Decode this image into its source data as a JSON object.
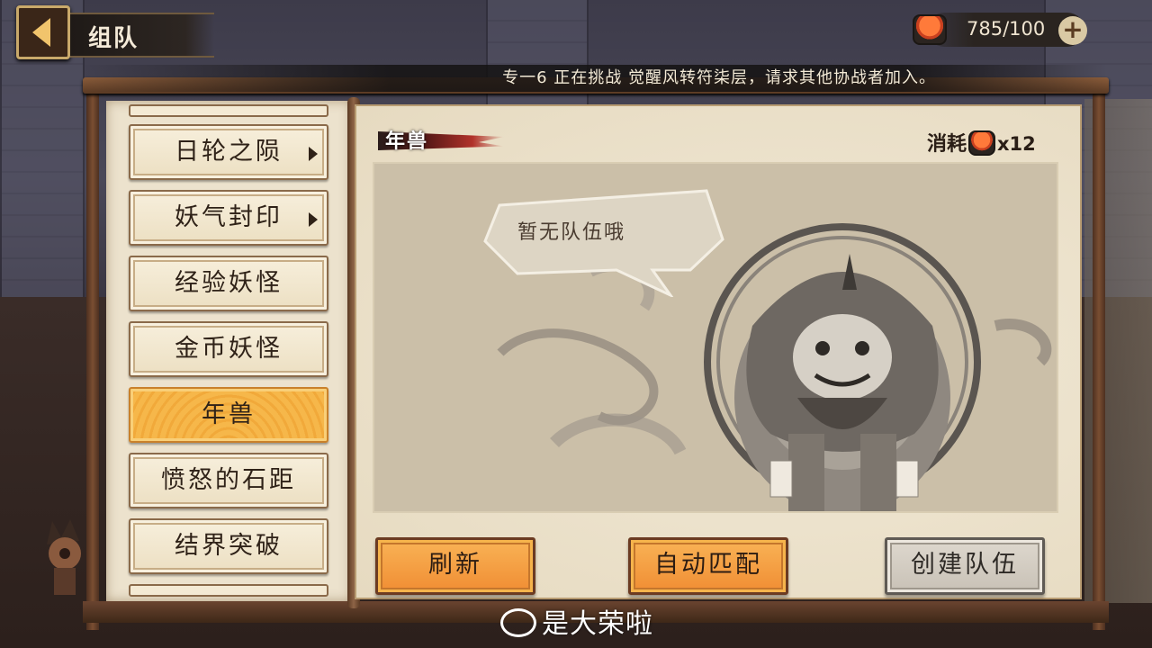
{
  "header": {
    "title": "组队",
    "currency_value": "785/100",
    "currency_icon": "sushi-icon",
    "plus_label": "+"
  },
  "notice": "专一6 正在挑战 觉醒风转符柒层，请求其他协战者加入。",
  "menu": {
    "items": [
      {
        "label": "日轮之陨",
        "has_arrow": true,
        "active": false
      },
      {
        "label": "妖气封印",
        "has_arrow": true,
        "active": false
      },
      {
        "label": "经验妖怪",
        "has_arrow": false,
        "active": false
      },
      {
        "label": "金币妖怪",
        "has_arrow": false,
        "active": false
      },
      {
        "label": "年兽",
        "has_arrow": false,
        "active": true
      },
      {
        "label": "愤怒的石距",
        "has_arrow": false,
        "active": false
      },
      {
        "label": "结界突破",
        "has_arrow": false,
        "active": false
      }
    ]
  },
  "panel": {
    "title": "年兽",
    "cost_label": "消耗",
    "cost_amount": "x12",
    "empty_message": "暂无队伍哦"
  },
  "buttons": {
    "refresh": "刷新",
    "auto_match": "自动匹配",
    "create_team": "创建队伍"
  },
  "watermark": "是大荣啦",
  "colors": {
    "active_item": "#f1a93a",
    "primary_button": "#f08d33",
    "disabled_button": "#c8c1b6"
  }
}
